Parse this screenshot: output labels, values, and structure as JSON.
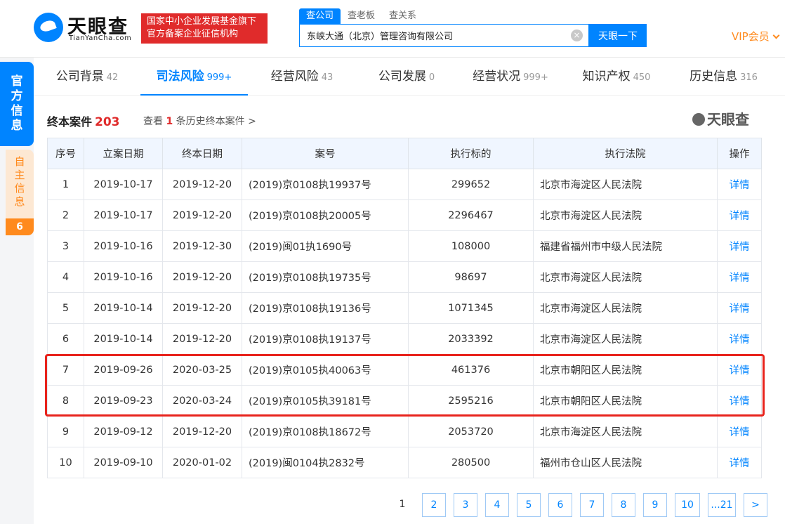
{
  "brand": {
    "name": "天眼查",
    "domain": "TianYanCha.com"
  },
  "notice": {
    "line1": "国家中小企业发展基金旗下",
    "line2": "官方备案企业征信机构"
  },
  "search": {
    "tabs": [
      "查公司",
      "查老板",
      "查关系"
    ],
    "value": "东峡大通（北京）管理咨询有限公司",
    "button": "天眼一下"
  },
  "vip": "VIP会员",
  "side": {
    "official": [
      "官",
      "方",
      "信",
      "息"
    ],
    "self": [
      "自",
      "主",
      "信",
      "息"
    ],
    "self_count": "6"
  },
  "nav": [
    {
      "label": "公司背景",
      "count": "42"
    },
    {
      "label": "司法风险",
      "count": "999+"
    },
    {
      "label": "经营风险",
      "count": "43"
    },
    {
      "label": "公司发展",
      "count": "0"
    },
    {
      "label": "经营状况",
      "count": "999+"
    },
    {
      "label": "知识产权",
      "count": "450"
    },
    {
      "label": "历史信息",
      "count": "316"
    }
  ],
  "section": {
    "title": "终本案件",
    "count": "203",
    "history_prefix": "查看",
    "history_num": "1",
    "history_suffix": "条历史终本案件 >",
    "watermark": "天眼查"
  },
  "table": {
    "headers": [
      "序号",
      "立案日期",
      "终本日期",
      "案号",
      "执行标的",
      "执行法院",
      "操作"
    ],
    "rows": [
      [
        "1",
        "2019-10-17",
        "2019-12-20",
        "(2019)京0108执19937号",
        "299652",
        "北京市海淀区人民法院",
        "详情"
      ],
      [
        "2",
        "2019-10-17",
        "2019-12-20",
        "(2019)京0108执20005号",
        "2296467",
        "北京市海淀区人民法院",
        "详情"
      ],
      [
        "3",
        "2019-10-16",
        "2019-12-30",
        "(2019)闽01执1690号",
        "108000",
        "福建省福州市中级人民法院",
        "详情"
      ],
      [
        "4",
        "2019-10-16",
        "2019-12-20",
        "(2019)京0108执19735号",
        "98697",
        "北京市海淀区人民法院",
        "详情"
      ],
      [
        "5",
        "2019-10-14",
        "2019-12-20",
        "(2019)京0108执19136号",
        "1071345",
        "北京市海淀区人民法院",
        "详情"
      ],
      [
        "6",
        "2019-10-14",
        "2019-12-20",
        "(2019)京0108执19137号",
        "2033392",
        "北京市海淀区人民法院",
        "详情"
      ],
      [
        "7",
        "2019-09-26",
        "2020-03-25",
        "(2019)京0105执40063号",
        "461376",
        "北京市朝阳区人民法院",
        "详情"
      ],
      [
        "8",
        "2019-09-23",
        "2020-03-24",
        "(2019)京0105执39181号",
        "2595216",
        "北京市朝阳区人民法院",
        "详情"
      ],
      [
        "9",
        "2019-09-12",
        "2019-12-20",
        "(2019)京0108执18672号",
        "2053720",
        "北京市海淀区人民法院",
        "详情"
      ],
      [
        "10",
        "2019-09-10",
        "2020-01-02",
        "(2019)闽0104执2832号",
        "280500",
        "福州市仓山区人民法院",
        "详情"
      ]
    ]
  },
  "pagination": [
    "1",
    "2",
    "3",
    "4",
    "5",
    "6",
    "7",
    "8",
    "9",
    "10",
    "...21",
    ">"
  ],
  "colors": {
    "accent": "#0084ff",
    "danger": "#e02b2b",
    "vip": "#ff8a1d"
  }
}
